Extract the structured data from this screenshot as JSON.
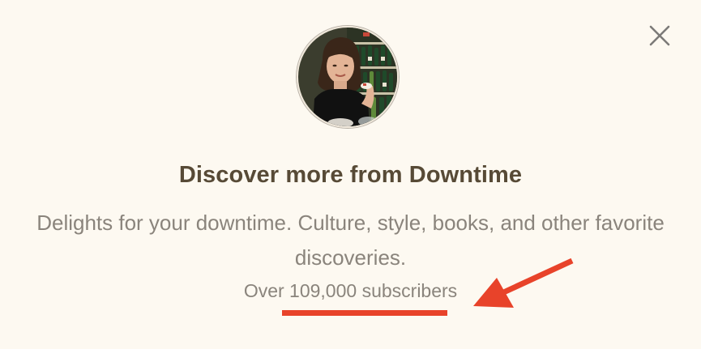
{
  "modal": {
    "title": "Discover more from Downtime",
    "description": "Delights for your downtime. Culture, style, books, and other favorite discoveries.",
    "subscribers": "Over 109,000 subscribers",
    "close_icon": "close-icon",
    "avatar_icon": "publication-avatar"
  },
  "colors": {
    "background": "#fdf9f1",
    "title": "#574a36",
    "text": "#8a847c",
    "annotation": "#e8432a"
  }
}
